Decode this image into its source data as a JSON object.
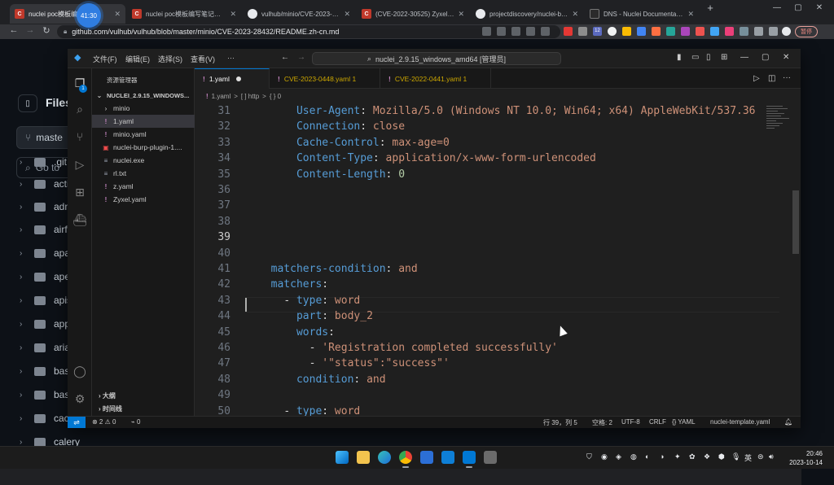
{
  "browser": {
    "tabs": [
      {
        "title": "nuclei poc模板编写笔记",
        "favicon_color": "#c0392b",
        "favicon_letter": "C"
      },
      {
        "title": "nuclei poc模板编写笔记（二）",
        "favicon_color": "#c0392b",
        "favicon_letter": "C"
      },
      {
        "title": "vulhub/minio/CVE-2023-2843",
        "favicon_color": "#e8eaed",
        "favicon_letter": ""
      },
      {
        "title": "(CVE-2022-30525) Zyxel 防",
        "favicon_color": "#c0392b",
        "favicon_letter": "C"
      },
      {
        "title": "projectdiscovery/nuclei-burp",
        "favicon_color": "#e8eaed",
        "favicon_letter": ""
      },
      {
        "title": "DNS - Nuclei Documentation",
        "favicon_color": "#2b2b2b",
        "favicon_letter": ""
      }
    ],
    "timer": "41:30",
    "url": "github.com/vulhub/vulhub/blob/master/minio/CVE-2023-28432/README.zh-cn.md",
    "profile_label": "暂停",
    "extension_badge": "12"
  },
  "github": {
    "files_title": "Files",
    "branch": "maste",
    "goto_placeholder": "Go to",
    "folders": [
      ".git",
      "acti",
      "adn",
      "airf",
      "apa",
      "ape",
      "apis",
      "app",
      "aria",
      "bas",
      "bas",
      "cac",
      "calery"
    ]
  },
  "vscode": {
    "menus": [
      "文件(F)",
      "编辑(E)",
      "选择(S)",
      "查看(V)",
      "···"
    ],
    "command_center": "nuclei_2.9.15_windows_amd64 [管理员]",
    "explorer_title": "资源管理器",
    "activity_badge": "1",
    "root_folder": "NUCLEI_2.9.15_WINDOWS...",
    "files": [
      {
        "name": "minio",
        "type": "folder"
      },
      {
        "name": "1.yaml",
        "type": "yaml",
        "selected": true
      },
      {
        "name": "minio.yaml",
        "type": "yaml"
      },
      {
        "name": "nuclei-burp-plugin-1....",
        "type": "jar"
      },
      {
        "name": "nuclei.exe",
        "type": "exe"
      },
      {
        "name": "rl.txt",
        "type": "txt"
      },
      {
        "name": "z.yaml",
        "type": "yaml"
      },
      {
        "name": "Zyxel.yaml",
        "type": "yaml"
      }
    ],
    "outline_label": "大纲",
    "timeline_label": "时间线",
    "tabs": [
      {
        "label": "1.yaml",
        "active": true,
        "dirty": true
      },
      {
        "label": "CVE-2023-0448.yaml 1",
        "active": false
      },
      {
        "label": "CVE-2022-0441.yaml 1",
        "active": false
      }
    ],
    "breadcrumb": [
      "1.yaml",
      ">",
      "[ ] http",
      ">",
      "{ } 0"
    ],
    "code_lines": [
      {
        "num": "31",
        "text": "      User-Agent: Mozilla/5.0 (Windows NT 10.0; Win64; x64) AppleWebKit/537.36"
      },
      {
        "num": "32",
        "text": "      Connection: close"
      },
      {
        "num": "33",
        "text": "      Cache-Control: max-age=0"
      },
      {
        "num": "34",
        "text": "      Content-Type: application/x-www-form-urlencoded"
      },
      {
        "num": "35",
        "text": "      Content-Length: 0"
      },
      {
        "num": "36",
        "text": ""
      },
      {
        "num": "37",
        "text": ""
      },
      {
        "num": "38",
        "text": ""
      },
      {
        "num": "39",
        "text": ""
      },
      {
        "num": "40",
        "text": ""
      },
      {
        "num": "41",
        "text": "  matchers-condition: and"
      },
      {
        "num": "42",
        "text": "  matchers:"
      },
      {
        "num": "43",
        "text": "    - type: word"
      },
      {
        "num": "44",
        "text": "      part: body_2"
      },
      {
        "num": "45",
        "text": "      words:"
      },
      {
        "num": "46",
        "text": "        - 'Registration completed successfully'"
      },
      {
        "num": "47",
        "text": "        - '\"status\":\"success\"'"
      },
      {
        "num": "48",
        "text": "      condition: and"
      },
      {
        "num": "49",
        "text": ""
      },
      {
        "num": "50",
        "text": "    - type: word"
      }
    ],
    "status": {
      "errors": "⊗ 2 ⚠ 0",
      "ports": "⌁ 0",
      "position": "行 39，列 5",
      "spaces": "空格: 2",
      "encoding": "UTF-8",
      "eol": "CRLF",
      "language": "{} YAML",
      "schema": "nuclei-template.yaml"
    }
  },
  "taskbar": {
    "ime": "英",
    "time": "20:46",
    "date": "2023-10-14"
  }
}
